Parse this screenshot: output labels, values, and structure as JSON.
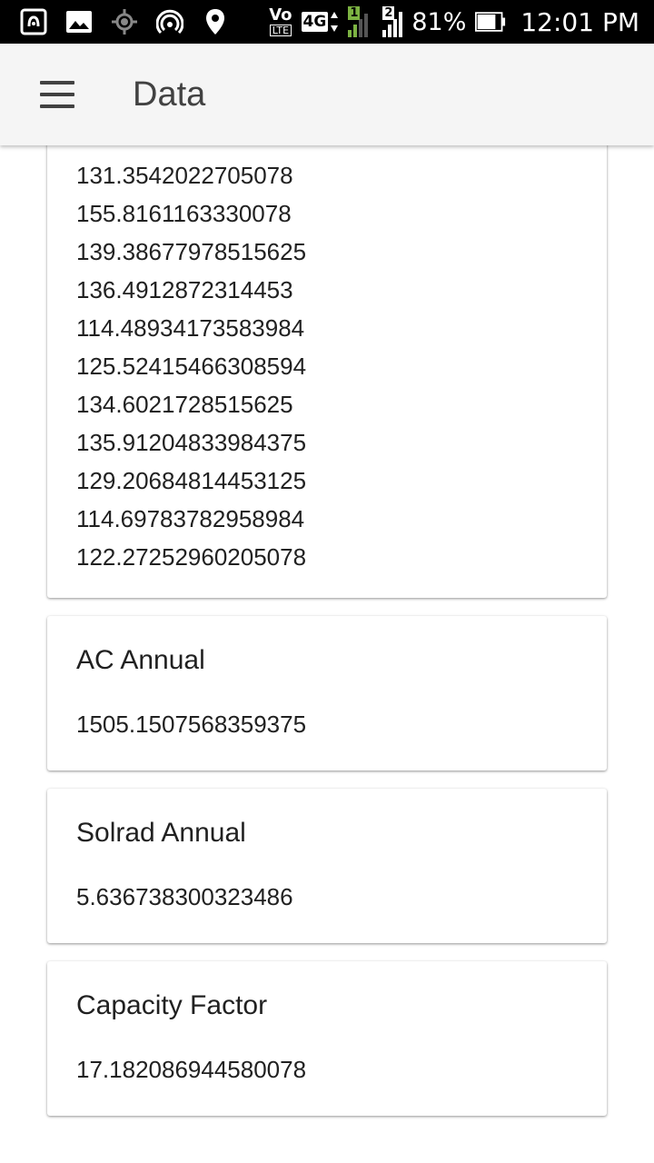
{
  "status_bar": {
    "battery": "81%",
    "time": "12:01 PM",
    "network": "4G",
    "volte_top": "Vo",
    "volte_bottom": "LTE",
    "sim1": "1",
    "sim2": "2",
    "icons": [
      "nfc-icon",
      "image-icon",
      "gps-icon",
      "hotspot-icon",
      "location-pin-icon",
      "volte-icon",
      "signal-icon",
      "battery-icon"
    ]
  },
  "app_bar": {
    "title": "Data",
    "menu_icon": "hamburger-menu-icon"
  },
  "monthly": [
    "131.3542022705078",
    "155.8161163330078",
    "139.38677978515625",
    "136.4912872314453",
    "114.48934173583984",
    "125.52415466308594",
    "134.6021728515625",
    "135.91204833984375",
    "129.20684814453125",
    "114.69783782958984",
    "122.27252960205078"
  ],
  "ac_annual": {
    "title": "AC Annual",
    "value": "1505.1507568359375"
  },
  "solrad_annual": {
    "title": "Solrad Annual",
    "value": "5.636738300323486"
  },
  "capacity_factor": {
    "title": "Capacity Factor",
    "value": "17.182086944580078"
  }
}
